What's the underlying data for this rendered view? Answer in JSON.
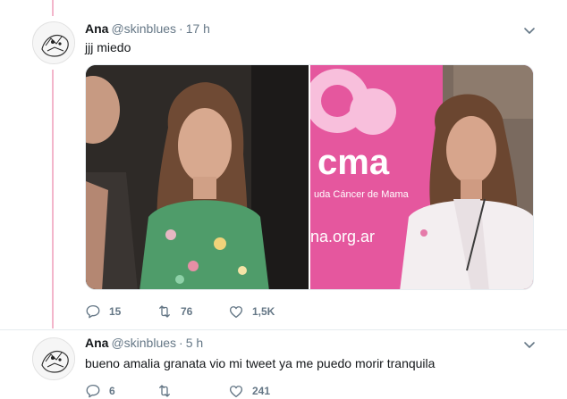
{
  "tweets": [
    {
      "name": "Ana",
      "handle": "@skinblues",
      "separator": "·",
      "time": "17 h",
      "text": "jjj miedo",
      "media": {
        "left_photo_icon": "photo-two-people",
        "right_photo": {
          "banner_text": "cma",
          "banner_subtext": "uda Cáncer de Mama",
          "banner_url_text": "na.org.ar"
        }
      },
      "replies": "15",
      "retweets": "76",
      "likes": "1,5K"
    },
    {
      "name": "Ana",
      "handle": "@skinblues",
      "separator": "·",
      "time": "5 h",
      "text": "bueno amalia granata vio mi tweet ya me puedo morir tranquila",
      "replies": "6",
      "retweets": "",
      "likes": "241"
    }
  ],
  "colors": {
    "thread_line": "#f3b6cb",
    "secondary_text": "#657786",
    "primary_text": "#14171a"
  }
}
